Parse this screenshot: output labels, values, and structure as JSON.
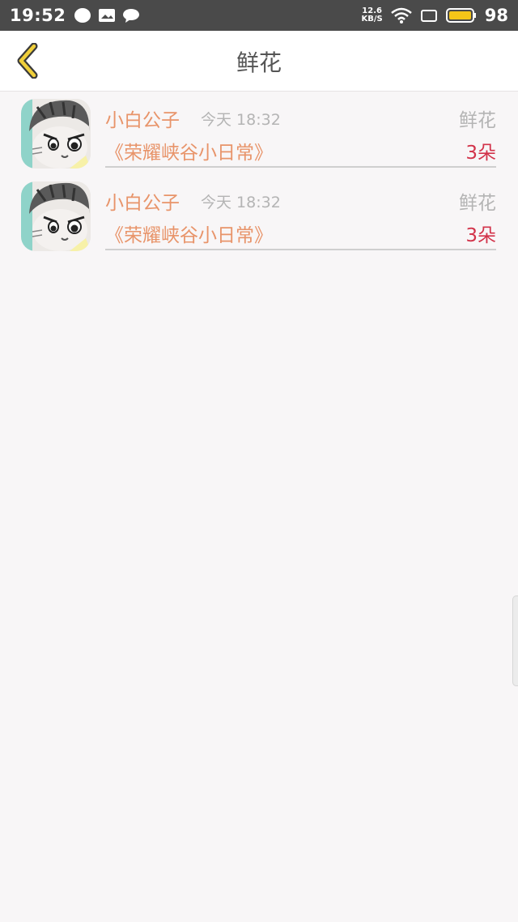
{
  "status_bar": {
    "time": "19:52",
    "net_speed_value": "12.6",
    "net_speed_unit": "KB/S",
    "battery": "98"
  },
  "header": {
    "title": "鲜花"
  },
  "records": [
    {
      "name": "小白公子",
      "time": "今天 18:32",
      "gift_type": "鲜花",
      "book": "《荣耀峡谷小日常》",
      "count": "3朵"
    },
    {
      "name": "小白公子",
      "time": "今天 18:32",
      "gift_type": "鲜花",
      "book": "《荣耀峡谷小日常》",
      "count": "3朵"
    }
  ],
  "colors": {
    "accent": "#e8946a",
    "count": "#d2334a",
    "back_arrow": "#f0cf3a"
  }
}
